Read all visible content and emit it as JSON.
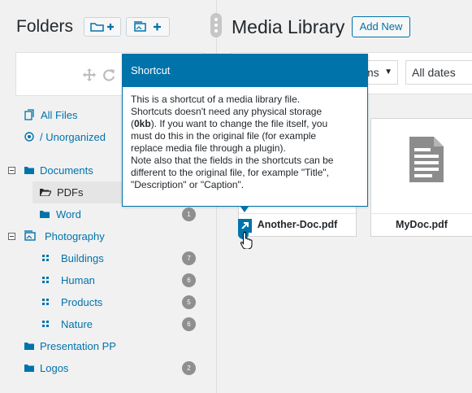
{
  "sidebar": {
    "title": "Folders",
    "buttons": {
      "new_folder": "new-folder-icon",
      "new_gallery": "new-gallery-icon"
    },
    "tree": [
      {
        "label": "All Files",
        "icon": "all-files-icon",
        "count": null
      },
      {
        "label": "/ Unorganized",
        "icon": "unorganized-icon",
        "count": null
      },
      {
        "label": "Documents",
        "icon": "folder-icon",
        "count": null,
        "expanded": true
      },
      {
        "label": "PDFs",
        "icon": "folder-open-icon",
        "count": null,
        "active": true
      },
      {
        "label": "Word",
        "icon": "folder-icon",
        "count": "1"
      },
      {
        "label": "Photography",
        "icon": "gallery-icon",
        "count": null,
        "expanded": true
      },
      {
        "label": "Buildings",
        "icon": "grid-icon",
        "count": "7"
      },
      {
        "label": "Human",
        "icon": "grid-icon",
        "count": "6"
      },
      {
        "label": "Products",
        "icon": "grid-icon",
        "count": "5"
      },
      {
        "label": "Nature",
        "icon": "grid-icon",
        "count": "6"
      },
      {
        "label": "Presentation PP",
        "icon": "folder-icon",
        "count": null
      },
      {
        "label": "Logos",
        "icon": "folder-icon",
        "count": "2"
      }
    ]
  },
  "main": {
    "title": "Media Library",
    "add_new_label": "Add New",
    "filters": {
      "type_value": "ms",
      "date_value": "All dates"
    },
    "files": [
      {
        "name": "Another-Doc.pdf",
        "shortcut": true
      },
      {
        "name": "MyDoc.pdf",
        "shortcut": false
      }
    ]
  },
  "tooltip": {
    "title": "Shortcut",
    "lines": [
      "This is a shortcut of a media library file.",
      "Shortcuts doesn't need any physical storage",
      "(0kb). If you want to change the file itself, you",
      "must do this in the original file (for example",
      "replace media file through a plugin).",
      "Note also that the fields in the shortcuts can be",
      "different to the original file, for example \"Title\",",
      "\"Description\" or \"Caption\"."
    ],
    "bold_text": "0kb"
  },
  "colors": {
    "accent": "#0073aa",
    "badge": "#8f8f8f",
    "background": "#f1f1f1"
  }
}
